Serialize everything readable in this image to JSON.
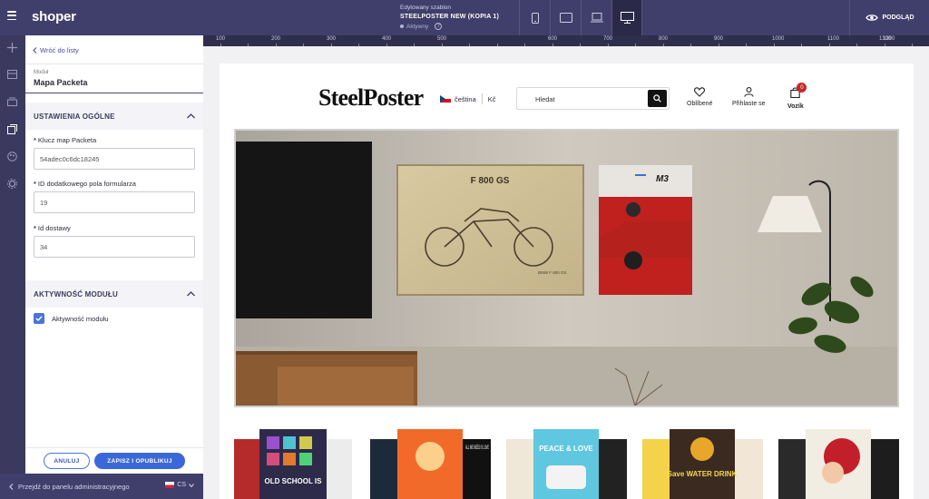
{
  "topbar": {
    "logo": "shoper",
    "template_caption": "Edytowany szablon",
    "template_name": "STEELPOSTER NEW (KOPIA 1)",
    "template_status": "Aktywny",
    "preview_label": "PODGLĄD",
    "devices": [
      "mobile-icon",
      "tablet-icon",
      "laptop-icon",
      "desktop-icon"
    ],
    "active_device": "desktop"
  },
  "panel": {
    "back_label": "Wróć do listy",
    "module_caption": "Moduł",
    "module_name": "Mapa Packeta",
    "section_general": "USTAWIENIA OGÓLNE",
    "fields": [
      {
        "label": "Klucz map Packeta",
        "value": "54adec0c6dc18245"
      },
      {
        "label": "ID dodatkowego pola formularza",
        "value": "19"
      },
      {
        "label": "Id dostawy",
        "value": "34"
      }
    ],
    "section_activity": "AKTYWNOŚĆ MODUŁU",
    "activity_checkbox_label": "Aktywność modułu",
    "activity_checked": true,
    "cancel_label": "ANULUJ",
    "save_label": "ZAPISZ I OPUBLIKUJ"
  },
  "admin_bar": {
    "label": "Przejdź do panelu administracyjnego",
    "lang": "CS"
  },
  "ruler": {
    "ticks": [
      "100",
      "200",
      "300",
      "400",
      "500",
      "600",
      "700",
      "800",
      "900",
      "1000",
      "1100",
      "1200",
      "1300"
    ]
  },
  "store": {
    "brand": "SteelPoster",
    "language": "čeština",
    "currency": "Kč",
    "search_placeholder": "Hledat",
    "favorites_label": "Oblíbené",
    "login_label": "Přihlaste se",
    "cart_label": "Vozík",
    "cart_count": "0",
    "poster1_title": "F 800 GS",
    "poster1_caption": "BMW F 800 GS",
    "poster2_title": "M3",
    "thumbs": [
      {
        "text": "OLD SCHOOL IS"
      },
      {
        "text": "ALL WE NEED IS LOVE"
      },
      {
        "text": "PEACE & LOVE"
      },
      {
        "text": "Save WATER DRINK"
      }
    ]
  },
  "colors": {
    "topbar": "#403e6b",
    "accent": "#3b68d8",
    "badge": "#c62828"
  }
}
